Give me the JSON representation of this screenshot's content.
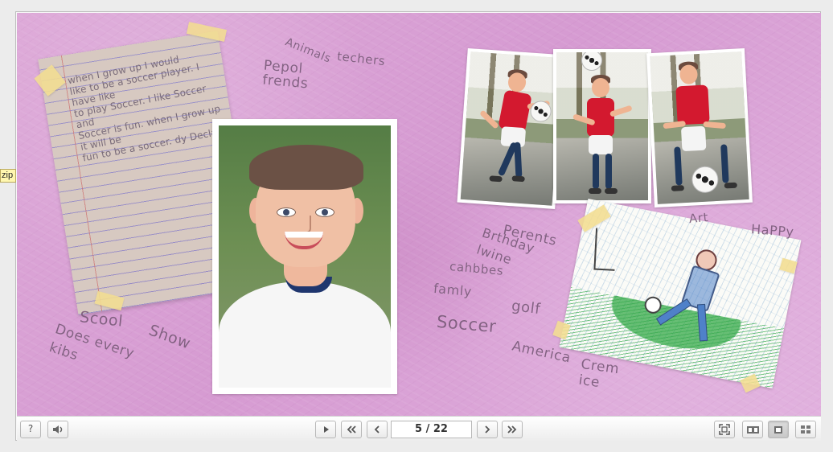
{
  "viewer": {
    "tooltip": "zip",
    "page_counter": "5 / 22"
  },
  "toolbar": {
    "help_icon": "?",
    "sound_icon": "speaker-icon",
    "play_icon": "play-icon",
    "first_icon": "first-page-icon",
    "previous_icon": "previous-page-icon",
    "next_icon": "next-page-icon",
    "last_icon": "last-page-icon",
    "fullscreen_icon": "fullscreen-icon",
    "double_page_icon": "double-page-icon",
    "single_page_icon": "single-page-icon",
    "thumbnail_icon": "thumbnail-grid-icon"
  },
  "scrapbook": {
    "letter": "when I grow up I would\nlike to be a soccer player. I have like\nto play Soccer. I like Soccer and\nSoccer is fun. when I grow up it will be\nfun to be a soccer. dy Declan",
    "doodles": [
      "Animals",
      "techers",
      "Pepol\nfrends",
      "Scool",
      "Does every\nkibs",
      "Show",
      "Perents",
      "Brthday\nlwine",
      "cahbbes",
      "famly",
      "golf",
      "Soccer",
      "America",
      "Crem\nice",
      "Art",
      "HaPPy"
    ]
  },
  "colors": {
    "page_background": "#d69bd2",
    "paper": "#d7c9c1",
    "tape": "#f2dd91",
    "jersey": "#d3192f",
    "toolbar": "#f7f7f7"
  }
}
